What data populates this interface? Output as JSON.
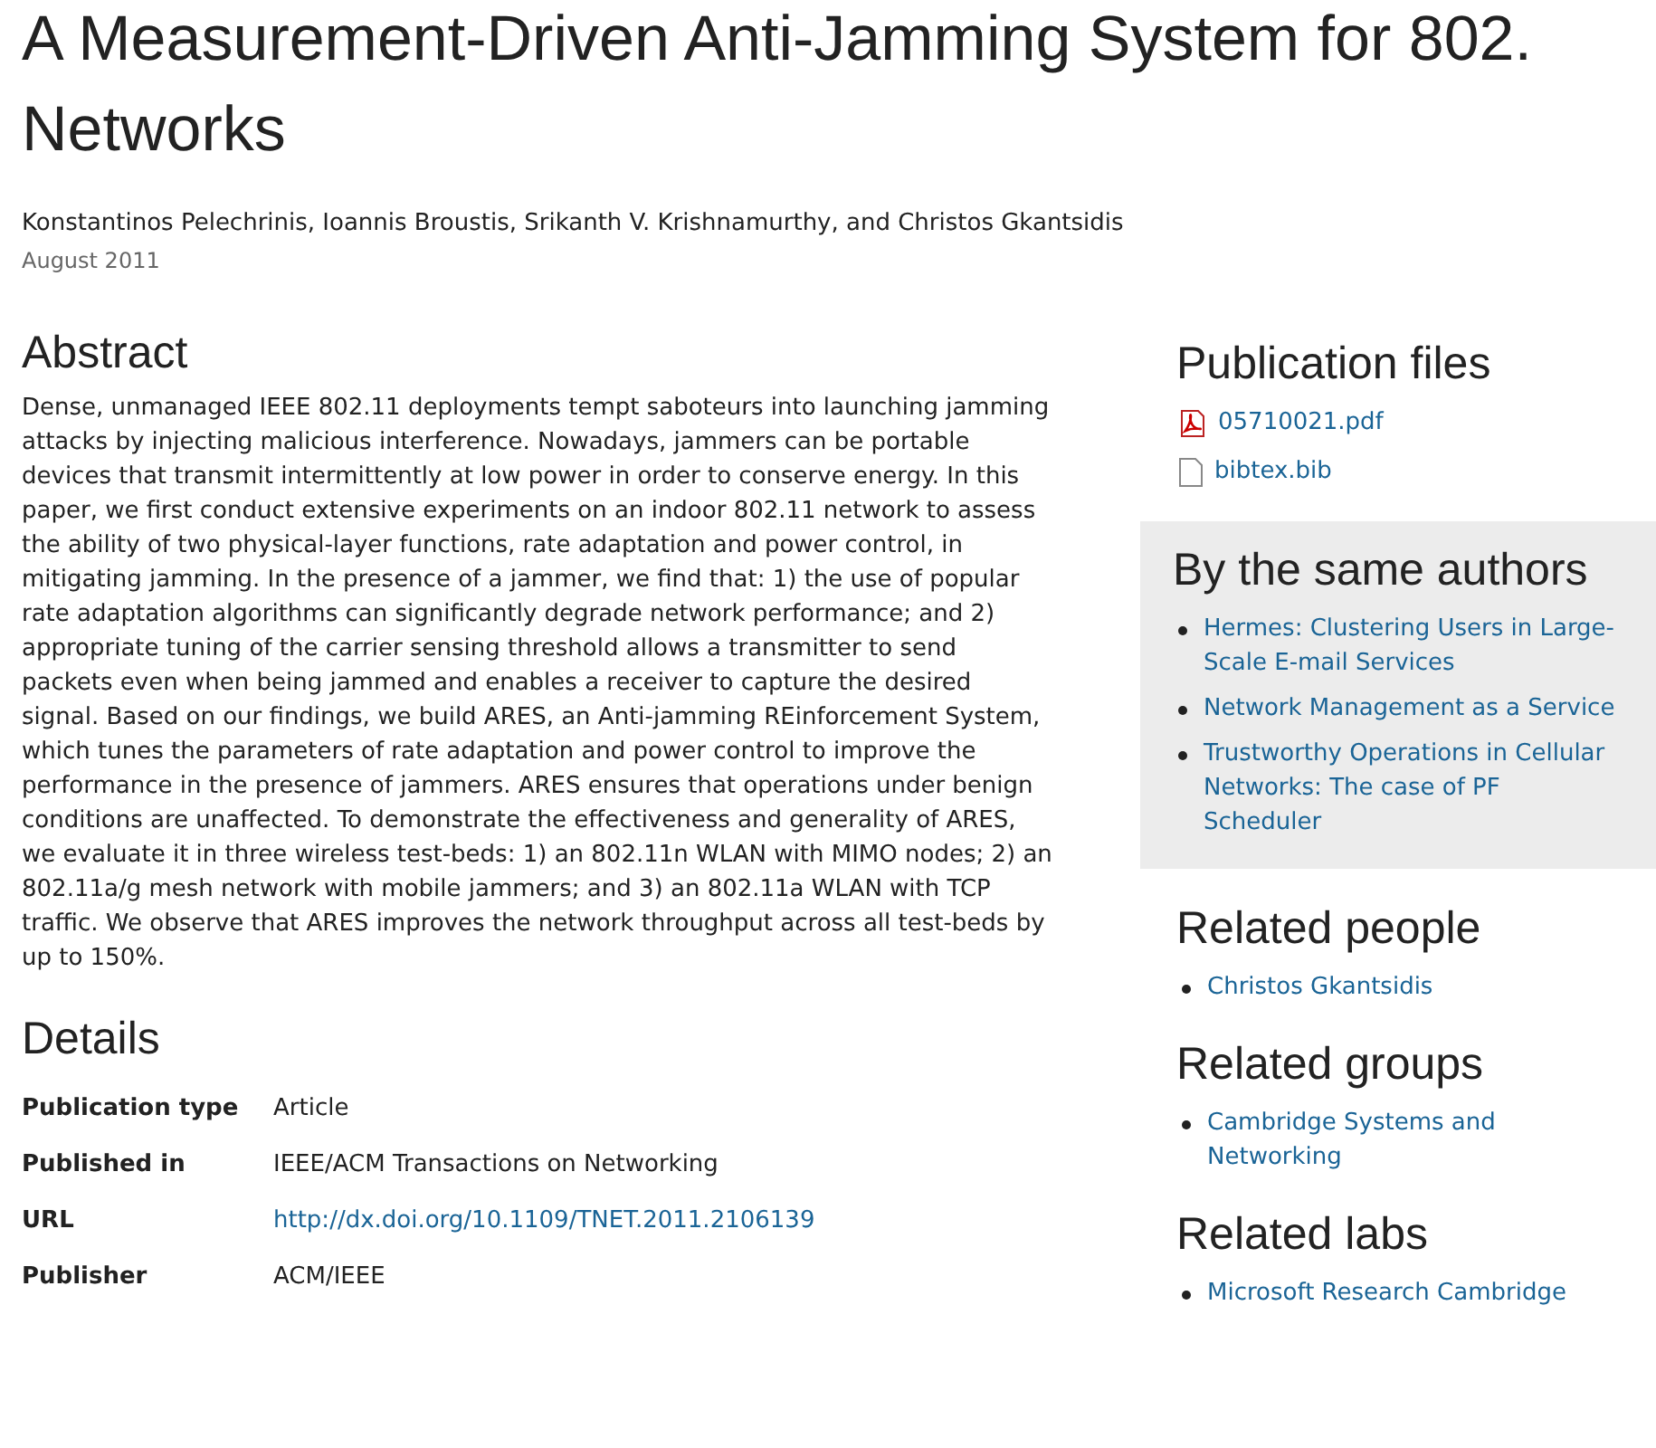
{
  "title": "A Measurement-Driven Anti-Jamming System for 802. Networks",
  "authors": "Konstantinos Pelechrinis, Ioannis Broustis, Srikanth V. Krishnamurthy, and Christos Gkantsidis",
  "date": "August 2011",
  "abstract": {
    "heading": "Abstract",
    "text": "Dense, unmanaged IEEE 802.11 deployments tempt saboteurs into launching jamming attacks by injecting malicious interference. Nowadays, jammers can be portable devices that transmit intermittently at low power in order to conserve energy. In this paper, we first conduct extensive experiments on an indoor 802.11 network to assess the ability of two physical-layer functions, rate adaptation and power control, in mitigating jamming. In the presence of a jammer, we find that: 1) the use of popular rate adaptation algorithms can significantly degrade network performance; and 2) appropriate tuning of the carrier sensing threshold allows a transmitter to send packets even when being jammed and enables a receiver to capture the desired signal. Based on our findings, we build ARES, an Anti-jamming REinforcement System, which tunes the parameters of rate adaptation and power control to improve the performance in the presence of jammers. ARES ensures that operations under benign conditions are unaffected. To demonstrate the effectiveness and generality of ARES, we evaluate it in three wireless test-beds: 1) an 802.11n WLAN with MIMO nodes; 2) an 802.11a/g mesh network with mobile jammers; and 3) an 802.11a WLAN with TCP traffic. We observe that ARES improves the network throughput across all test-beds by up to 150%."
  },
  "details": {
    "heading": "Details",
    "rows": [
      {
        "label": "Publication type",
        "value": "Article",
        "kind": "text"
      },
      {
        "label": "Published in",
        "value": "IEEE/ACM Transactions on Networking",
        "kind": "text"
      },
      {
        "label": "URL",
        "value": "http://dx.doi.org/10.1109/TNET.2011.2106139",
        "kind": "link"
      },
      {
        "label": "Publisher",
        "value": "ACM/IEEE",
        "kind": "text"
      }
    ]
  },
  "sidebar": {
    "files": {
      "heading": "Publication files",
      "items": [
        {
          "name": "05710021.pdf",
          "kind": "pdf"
        },
        {
          "name": "bibtex.bib",
          "kind": "file"
        }
      ]
    },
    "same_authors": {
      "heading": "By the same authors",
      "items": [
        "Hermes: Clustering Users in Large-Scale E-mail Services",
        "Network Management as a Service",
        "Trustworthy Operations in Cellular Networks: The case of PF Scheduler"
      ]
    },
    "related_people": {
      "heading": "Related people",
      "items": [
        "Christos Gkantsidis"
      ]
    },
    "related_groups": {
      "heading": "Related groups",
      "items": [
        "Cambridge Systems and Networking"
      ]
    },
    "related_labs": {
      "heading": "Related labs",
      "items": [
        "Microsoft Research Cambridge"
      ]
    }
  }
}
